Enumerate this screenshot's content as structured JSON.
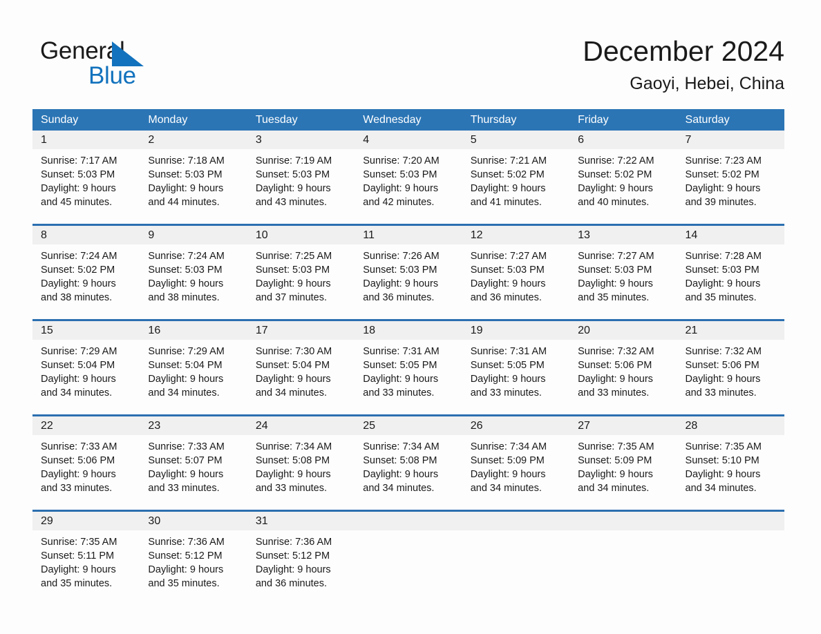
{
  "brand": {
    "name_part1": "General",
    "name_part2": "Blue",
    "accent_color": "#1272bd",
    "triangle_icon": "triangle-icon"
  },
  "header": {
    "title": "December 2024",
    "subtitle": "Gaoyi, Hebei, China"
  },
  "theme": {
    "header_blue": "#2b75b5",
    "row_divider_blue": "#2b6fb0",
    "day_band_gray": "#f0f0f0",
    "page_background": "#fdfdfd"
  },
  "calendar": {
    "day_headers": [
      "Sunday",
      "Monday",
      "Tuesday",
      "Wednesday",
      "Thursday",
      "Friday",
      "Saturday"
    ],
    "weeks": [
      [
        {
          "day": "1",
          "sunrise": "Sunrise: 7:17 AM",
          "sunset": "Sunset: 5:03 PM",
          "daylight_line1": "Daylight: 9 hours",
          "daylight_line2": "and 45 minutes."
        },
        {
          "day": "2",
          "sunrise": "Sunrise: 7:18 AM",
          "sunset": "Sunset: 5:03 PM",
          "daylight_line1": "Daylight: 9 hours",
          "daylight_line2": "and 44 minutes."
        },
        {
          "day": "3",
          "sunrise": "Sunrise: 7:19 AM",
          "sunset": "Sunset: 5:03 PM",
          "daylight_line1": "Daylight: 9 hours",
          "daylight_line2": "and 43 minutes."
        },
        {
          "day": "4",
          "sunrise": "Sunrise: 7:20 AM",
          "sunset": "Sunset: 5:03 PM",
          "daylight_line1": "Daylight: 9 hours",
          "daylight_line2": "and 42 minutes."
        },
        {
          "day": "5",
          "sunrise": "Sunrise: 7:21 AM",
          "sunset": "Sunset: 5:02 PM",
          "daylight_line1": "Daylight: 9 hours",
          "daylight_line2": "and 41 minutes."
        },
        {
          "day": "6",
          "sunrise": "Sunrise: 7:22 AM",
          "sunset": "Sunset: 5:02 PM",
          "daylight_line1": "Daylight: 9 hours",
          "daylight_line2": "and 40 minutes."
        },
        {
          "day": "7",
          "sunrise": "Sunrise: 7:23 AM",
          "sunset": "Sunset: 5:02 PM",
          "daylight_line1": "Daylight: 9 hours",
          "daylight_line2": "and 39 minutes."
        }
      ],
      [
        {
          "day": "8",
          "sunrise": "Sunrise: 7:24 AM",
          "sunset": "Sunset: 5:02 PM",
          "daylight_line1": "Daylight: 9 hours",
          "daylight_line2": "and 38 minutes."
        },
        {
          "day": "9",
          "sunrise": "Sunrise: 7:24 AM",
          "sunset": "Sunset: 5:03 PM",
          "daylight_line1": "Daylight: 9 hours",
          "daylight_line2": "and 38 minutes."
        },
        {
          "day": "10",
          "sunrise": "Sunrise: 7:25 AM",
          "sunset": "Sunset: 5:03 PM",
          "daylight_line1": "Daylight: 9 hours",
          "daylight_line2": "and 37 minutes."
        },
        {
          "day": "11",
          "sunrise": "Sunrise: 7:26 AM",
          "sunset": "Sunset: 5:03 PM",
          "daylight_line1": "Daylight: 9 hours",
          "daylight_line2": "and 36 minutes."
        },
        {
          "day": "12",
          "sunrise": "Sunrise: 7:27 AM",
          "sunset": "Sunset: 5:03 PM",
          "daylight_line1": "Daylight: 9 hours",
          "daylight_line2": "and 36 minutes."
        },
        {
          "day": "13",
          "sunrise": "Sunrise: 7:27 AM",
          "sunset": "Sunset: 5:03 PM",
          "daylight_line1": "Daylight: 9 hours",
          "daylight_line2": "and 35 minutes."
        },
        {
          "day": "14",
          "sunrise": "Sunrise: 7:28 AM",
          "sunset": "Sunset: 5:03 PM",
          "daylight_line1": "Daylight: 9 hours",
          "daylight_line2": "and 35 minutes."
        }
      ],
      [
        {
          "day": "15",
          "sunrise": "Sunrise: 7:29 AM",
          "sunset": "Sunset: 5:04 PM",
          "daylight_line1": "Daylight: 9 hours",
          "daylight_line2": "and 34 minutes."
        },
        {
          "day": "16",
          "sunrise": "Sunrise: 7:29 AM",
          "sunset": "Sunset: 5:04 PM",
          "daylight_line1": "Daylight: 9 hours",
          "daylight_line2": "and 34 minutes."
        },
        {
          "day": "17",
          "sunrise": "Sunrise: 7:30 AM",
          "sunset": "Sunset: 5:04 PM",
          "daylight_line1": "Daylight: 9 hours",
          "daylight_line2": "and 34 minutes."
        },
        {
          "day": "18",
          "sunrise": "Sunrise: 7:31 AM",
          "sunset": "Sunset: 5:05 PM",
          "daylight_line1": "Daylight: 9 hours",
          "daylight_line2": "and 33 minutes."
        },
        {
          "day": "19",
          "sunrise": "Sunrise: 7:31 AM",
          "sunset": "Sunset: 5:05 PM",
          "daylight_line1": "Daylight: 9 hours",
          "daylight_line2": "and 33 minutes."
        },
        {
          "day": "20",
          "sunrise": "Sunrise: 7:32 AM",
          "sunset": "Sunset: 5:06 PM",
          "daylight_line1": "Daylight: 9 hours",
          "daylight_line2": "and 33 minutes."
        },
        {
          "day": "21",
          "sunrise": "Sunrise: 7:32 AM",
          "sunset": "Sunset: 5:06 PM",
          "daylight_line1": "Daylight: 9 hours",
          "daylight_line2": "and 33 minutes."
        }
      ],
      [
        {
          "day": "22",
          "sunrise": "Sunrise: 7:33 AM",
          "sunset": "Sunset: 5:06 PM",
          "daylight_line1": "Daylight: 9 hours",
          "daylight_line2": "and 33 minutes."
        },
        {
          "day": "23",
          "sunrise": "Sunrise: 7:33 AM",
          "sunset": "Sunset: 5:07 PM",
          "daylight_line1": "Daylight: 9 hours",
          "daylight_line2": "and 33 minutes."
        },
        {
          "day": "24",
          "sunrise": "Sunrise: 7:34 AM",
          "sunset": "Sunset: 5:08 PM",
          "daylight_line1": "Daylight: 9 hours",
          "daylight_line2": "and 33 minutes."
        },
        {
          "day": "25",
          "sunrise": "Sunrise: 7:34 AM",
          "sunset": "Sunset: 5:08 PM",
          "daylight_line1": "Daylight: 9 hours",
          "daylight_line2": "and 34 minutes."
        },
        {
          "day": "26",
          "sunrise": "Sunrise: 7:34 AM",
          "sunset": "Sunset: 5:09 PM",
          "daylight_line1": "Daylight: 9 hours",
          "daylight_line2": "and 34 minutes."
        },
        {
          "day": "27",
          "sunrise": "Sunrise: 7:35 AM",
          "sunset": "Sunset: 5:09 PM",
          "daylight_line1": "Daylight: 9 hours",
          "daylight_line2": "and 34 minutes."
        },
        {
          "day": "28",
          "sunrise": "Sunrise: 7:35 AM",
          "sunset": "Sunset: 5:10 PM",
          "daylight_line1": "Daylight: 9 hours",
          "daylight_line2": "and 34 minutes."
        }
      ],
      [
        {
          "day": "29",
          "sunrise": "Sunrise: 7:35 AM",
          "sunset": "Sunset: 5:11 PM",
          "daylight_line1": "Daylight: 9 hours",
          "daylight_line2": "and 35 minutes."
        },
        {
          "day": "30",
          "sunrise": "Sunrise: 7:36 AM",
          "sunset": "Sunset: 5:12 PM",
          "daylight_line1": "Daylight: 9 hours",
          "daylight_line2": "and 35 minutes."
        },
        {
          "day": "31",
          "sunrise": "Sunrise: 7:36 AM",
          "sunset": "Sunset: 5:12 PM",
          "daylight_line1": "Daylight: 9 hours",
          "daylight_line2": "and 36 minutes."
        },
        {
          "day": "",
          "sunrise": "",
          "sunset": "",
          "daylight_line1": "",
          "daylight_line2": ""
        },
        {
          "day": "",
          "sunrise": "",
          "sunset": "",
          "daylight_line1": "",
          "daylight_line2": ""
        },
        {
          "day": "",
          "sunrise": "",
          "sunset": "",
          "daylight_line1": "",
          "daylight_line2": ""
        },
        {
          "day": "",
          "sunrise": "",
          "sunset": "",
          "daylight_line1": "",
          "daylight_line2": ""
        }
      ]
    ]
  }
}
